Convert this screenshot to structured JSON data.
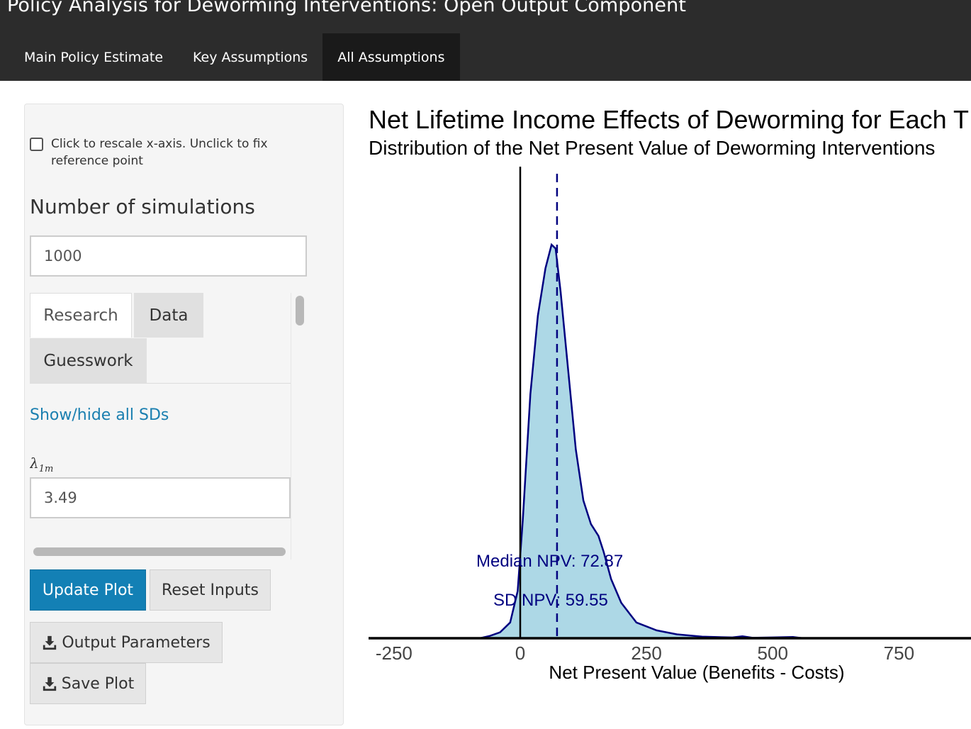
{
  "header": {
    "app_title": "Policy Analysis for Deworming Interventions: Open Output Component",
    "tabs": [
      {
        "label": "Main Policy Estimate",
        "active": false
      },
      {
        "label": "Key Assumptions",
        "active": false
      },
      {
        "label": "All Assumptions",
        "active": true
      }
    ]
  },
  "sidebar": {
    "rescale_checkbox": {
      "label": "Click to rescale x-axis. Unclick to fix reference point",
      "checked": false
    },
    "simulations": {
      "label": "Number of simulations",
      "value": "1000"
    },
    "panel_tabs": [
      {
        "label": "Research",
        "active": true
      },
      {
        "label": "Data",
        "active": false
      },
      {
        "label": "Guesswork",
        "active": false
      }
    ],
    "show_hide_link": "Show/hide all SDs",
    "lambda_field": {
      "symbol": "λ",
      "subscript": "1m",
      "value": "3.49"
    },
    "buttons": {
      "update": "Update Plot",
      "reset": "Reset Inputs",
      "output": "Output Parameters",
      "save": "Save Plot"
    },
    "icons": {
      "download": "download-icon"
    }
  },
  "colors": {
    "header_bg": "#2c2c2c",
    "active_tab_bg": "#1a1a1a",
    "primary_button": "#1380b5",
    "link": "#1a7fb0",
    "density_fill": "#add8e6",
    "density_line": "#000080"
  },
  "chart_data": {
    "type": "area",
    "title": "Net Lifetime Income Effects of Deworming for Each T",
    "subtitle": "Distribution of the Net Present Value of Deworming Interventions",
    "xlabel": "Net Present Value (Benefits -  Costs)",
    "ylabel": "",
    "xlim": [
      -300,
      800
    ],
    "x_ticks": [
      -250,
      0,
      250,
      500,
      750
    ],
    "grid": false,
    "median_npv": 72.87,
    "sd_npv": 59.55,
    "annotations": [
      "Median NPV:  72.87",
      "SD NPV:  59.55"
    ],
    "series": [
      {
        "x": [
          -80,
          -60,
          -40,
          -20,
          -5,
          5,
          20,
          35,
          50,
          62,
          70,
          80,
          95,
          110,
          125,
          140,
          155,
          165,
          180,
          200,
          230,
          270,
          310,
          360,
          420,
          440,
          460,
          500,
          540,
          560
        ],
        "y": [
          0.0,
          0.006,
          0.015,
          0.04,
          0.12,
          0.3,
          0.62,
          0.82,
          0.94,
          1.0,
          0.99,
          0.88,
          0.68,
          0.48,
          0.35,
          0.29,
          0.26,
          0.22,
          0.15,
          0.09,
          0.04,
          0.02,
          0.01,
          0.004,
          0.002,
          0.005,
          0.001,
          0.002,
          0.003,
          0.0
        ]
      }
    ]
  }
}
